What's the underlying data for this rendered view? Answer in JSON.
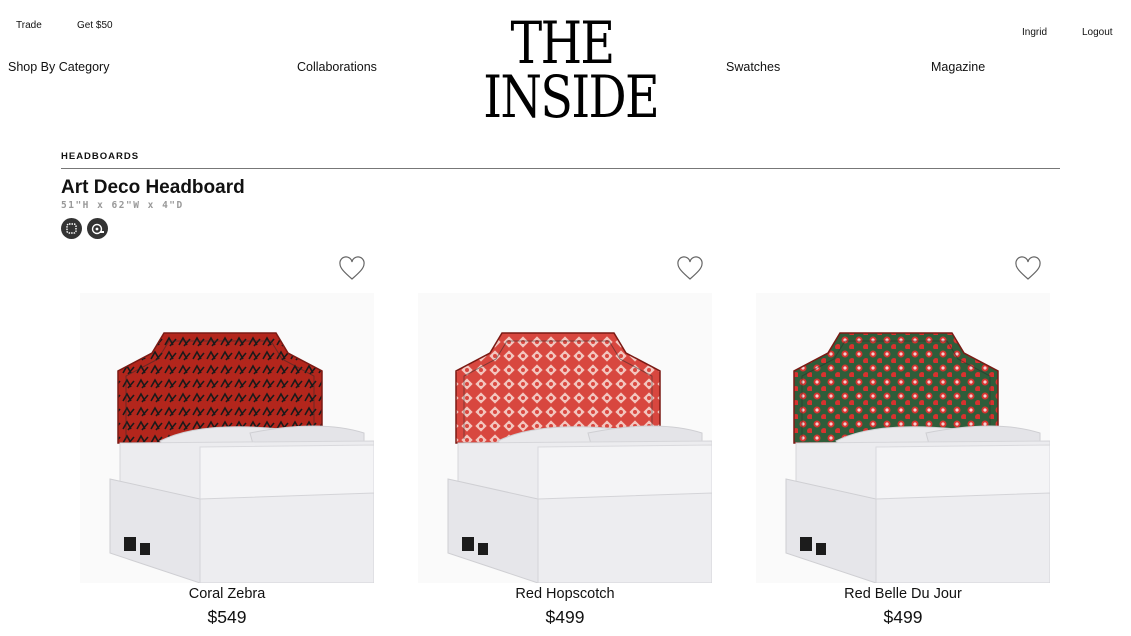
{
  "utility": {
    "trade": "Trade",
    "get50": "Get $50",
    "user": "Ingrid",
    "logout": "Logout"
  },
  "nav": {
    "shop": "Shop By Category",
    "collaborations": "Collaborations",
    "swatches": "Swatches",
    "magazine": "Magazine"
  },
  "logo": {
    "line1": "THE",
    "line2": "INSIDE"
  },
  "breadcrumb": "HEADBOARDS",
  "product": {
    "title": "Art Deco Headboard",
    "dimensions": "51\"H x 62\"W x 4\"D",
    "badges": [
      {
        "icon": "upholstery-icon"
      },
      {
        "icon": "tape-measure-icon"
      }
    ]
  },
  "colors": {
    "text": "#111111",
    "rule": "#777777",
    "badge": "#333333",
    "muted": "#999999"
  },
  "cards": [
    {
      "name": "Coral Zebra",
      "price": "$549",
      "fabric_color": "#b3261c",
      "pattern_color": "#1a1a1a",
      "pattern": "zebra"
    },
    {
      "name": "Red Hopscotch",
      "price": "$499",
      "fabric_color": "#d8473f",
      "pattern_color": "#f3c6bf",
      "pattern": "hopscotch"
    },
    {
      "name": "Red Belle Du Jour",
      "price": "$499",
      "fabric_color": "#2f5d3a",
      "pattern_color": "#d8322f",
      "pattern": "floral"
    }
  ]
}
